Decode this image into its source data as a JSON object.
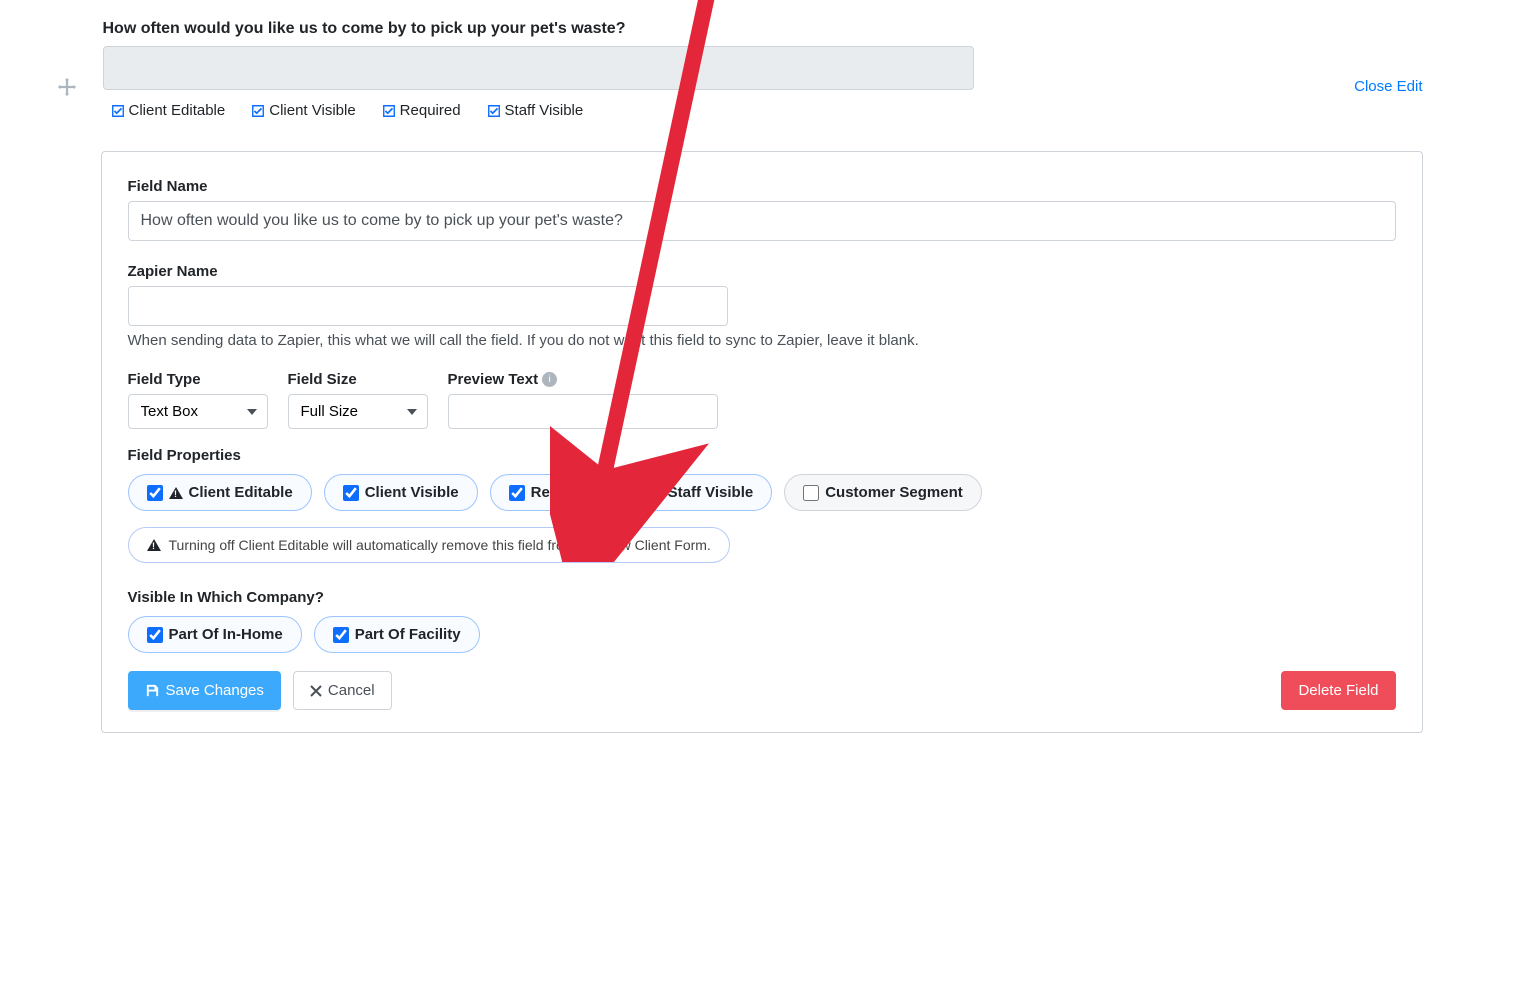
{
  "header": {
    "question": "How often would you like us to come by to pick up your pet's waste?",
    "close_edit": "Close Edit",
    "summary": {
      "client_editable": "Client Editable",
      "client_visible": "Client Visible",
      "required": "Required",
      "staff_visible": "Staff Visible"
    }
  },
  "panel": {
    "field_name_label": "Field Name",
    "field_name_value": "How often would you like us to come by to pick up your pet's waste?",
    "zapier_label": "Zapier Name",
    "zapier_value": "",
    "zapier_hint": "When sending data to Zapier, this what we will call the field. If you do not want this field to sync to Zapier, leave it blank.",
    "field_type_label": "Field Type",
    "field_type_value": "Text Box",
    "field_size_label": "Field Size",
    "field_size_value": "Full Size",
    "preview_text_label": "Preview Text",
    "preview_text_value": "",
    "properties_label": "Field Properties",
    "properties": {
      "client_editable": "Client Editable",
      "client_visible": "Client Visible",
      "required": "Required",
      "staff_visible": "Staff Visible",
      "customer_segment": "Customer Segment"
    },
    "info_pill": "Turning off Client Editable will automatically remove this field from the New Client Form.",
    "company_label": "Visible In Which Company?",
    "company": {
      "in_home": "Part Of In-Home",
      "facility": "Part Of Facility"
    }
  },
  "footer": {
    "save": "Save Changes",
    "cancel": "Cancel",
    "delete": "Delete Field"
  }
}
